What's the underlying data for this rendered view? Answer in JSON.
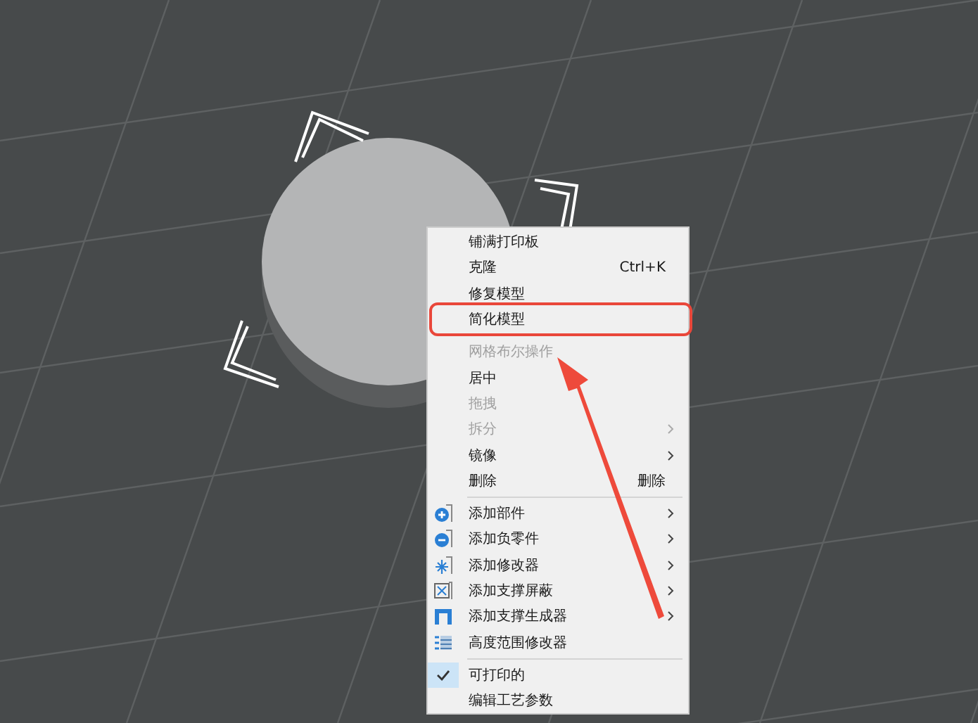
{
  "context_menu": {
    "sections": [
      {
        "items": [
          {
            "label": "铺满打印板",
            "disabled": false,
            "submenu": false,
            "marked": false
          },
          {
            "label": "克隆",
            "shortcut": "Ctrl+K",
            "disabled": false,
            "submenu": false,
            "marked": false
          },
          {
            "label": "修复模型",
            "disabled": false,
            "submenu": false,
            "marked": false
          },
          {
            "label": "简化模型",
            "disabled": false,
            "submenu": false,
            "marked": true
          }
        ]
      },
      {
        "items": [
          {
            "label": "网格布尔操作",
            "disabled": true,
            "submenu": false,
            "marked": false
          },
          {
            "label": "居中",
            "disabled": false,
            "submenu": false,
            "marked": false
          },
          {
            "label": "拖拽",
            "disabled": true,
            "submenu": false,
            "marked": false
          },
          {
            "label": "拆分",
            "disabled": true,
            "submenu": true,
            "marked": false
          },
          {
            "label": "镜像",
            "disabled": false,
            "submenu": true,
            "marked": false
          },
          {
            "label": "删除",
            "shortcut": "删除",
            "disabled": false,
            "submenu": false,
            "marked": false
          }
        ]
      },
      {
        "items": [
          {
            "label": "添加部件",
            "disabled": false,
            "submenu": true,
            "marked": false
          },
          {
            "label": "添加负零件",
            "disabled": false,
            "submenu": true,
            "marked": false
          },
          {
            "label": "添加修改器",
            "disabled": false,
            "submenu": true,
            "marked": false
          },
          {
            "label": "添加支撑屏蔽",
            "disabled": false,
            "submenu": true,
            "marked": false
          },
          {
            "label": "添加支撑生成器",
            "disabled": false,
            "submenu": true,
            "marked": false
          },
          {
            "label": "高度范围修改器",
            "disabled": false,
            "submenu": false,
            "marked": false
          }
        ]
      },
      {
        "items": [
          {
            "label": "可打印的",
            "disabled": false,
            "submenu": false,
            "marked": false,
            "checked": true
          },
          {
            "label": "编辑工艺参数",
            "disabled": false,
            "submenu": false,
            "marked": false,
            "checked": false
          }
        ]
      }
    ]
  }
}
